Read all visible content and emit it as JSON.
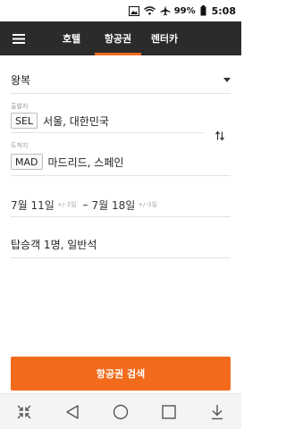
{
  "status_bar": {
    "battery": "99%",
    "time": "5:08",
    "icons": [
      "notification-image-icon",
      "wifi-icon",
      "airplane-mode-icon",
      "battery-icon"
    ]
  },
  "top_nav": {
    "menu_icon": "hamburger-menu-icon",
    "tabs": [
      {
        "label": "호텔",
        "active": false
      },
      {
        "label": "항공권",
        "active": true
      },
      {
        "label": "렌터카",
        "active": false
      }
    ],
    "accent_color": "#f26b1d",
    "bar_color": "#2b2b2b"
  },
  "form": {
    "trip_type": "왕복",
    "origin": {
      "label": "출발지",
      "code": "SEL",
      "city": "서울, 대한민국"
    },
    "destination": {
      "label": "도착지",
      "code": "MAD",
      "city": "마드리드, 스페인"
    },
    "swap_icon": "swap-vertical-icon",
    "dates": {
      "depart": "7월 11일",
      "depart_flex": "+/-3일",
      "separator": "–",
      "return": "7월 18일",
      "return_flex": "+/-3일"
    },
    "passengers": "탑승객 1명, 일반석"
  },
  "search_button": {
    "label": "항공권 검색"
  },
  "system_nav": {
    "icons": [
      "collapse-icon",
      "back-icon",
      "home-icon",
      "recents-icon",
      "notification-pull-icon"
    ]
  }
}
